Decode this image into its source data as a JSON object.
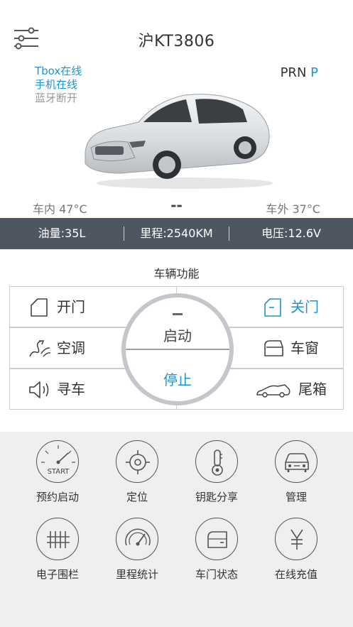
{
  "header": {
    "title": "沪KT3806",
    "menu_icon": "filter-sliders-icon"
  },
  "status": {
    "tbox": "Tbox在线",
    "phone": "手机在线",
    "bluetooth": "蓝牙断开"
  },
  "gear": {
    "options": "PRN",
    "current": "P"
  },
  "temperature": {
    "inside": "车内 47°C",
    "middle": "--",
    "outside": "车外 37°C"
  },
  "infobar": {
    "fuel": "油量:35L",
    "mileage": "里程:2540KM",
    "voltage": "电压:12.6V"
  },
  "functions": {
    "title": "车辆功能",
    "open_door": "开门",
    "close_door": "关门",
    "ac": "空调",
    "window": "车窗",
    "find_car": "寻车",
    "trunk": "尾箱",
    "start": "启动",
    "stop": "停止"
  },
  "grid": {
    "items": [
      {
        "label": "预约启动",
        "icon": "start-gauge-icon"
      },
      {
        "label": "定位",
        "icon": "location-target-icon"
      },
      {
        "label": "钥匙分享",
        "icon": "key-share-icon"
      },
      {
        "label": "管理",
        "icon": "car-manage-icon"
      },
      {
        "label": "电子围栏",
        "icon": "fence-icon"
      },
      {
        "label": "里程统计",
        "icon": "speedometer-icon"
      },
      {
        "label": "车门状态",
        "icon": "door-status-icon"
      },
      {
        "label": "在线充值",
        "icon": "yuan-icon"
      }
    ]
  },
  "colors": {
    "accent": "#1a94d6",
    "bar": "#4d5661",
    "grid_bg": "#efefef"
  }
}
